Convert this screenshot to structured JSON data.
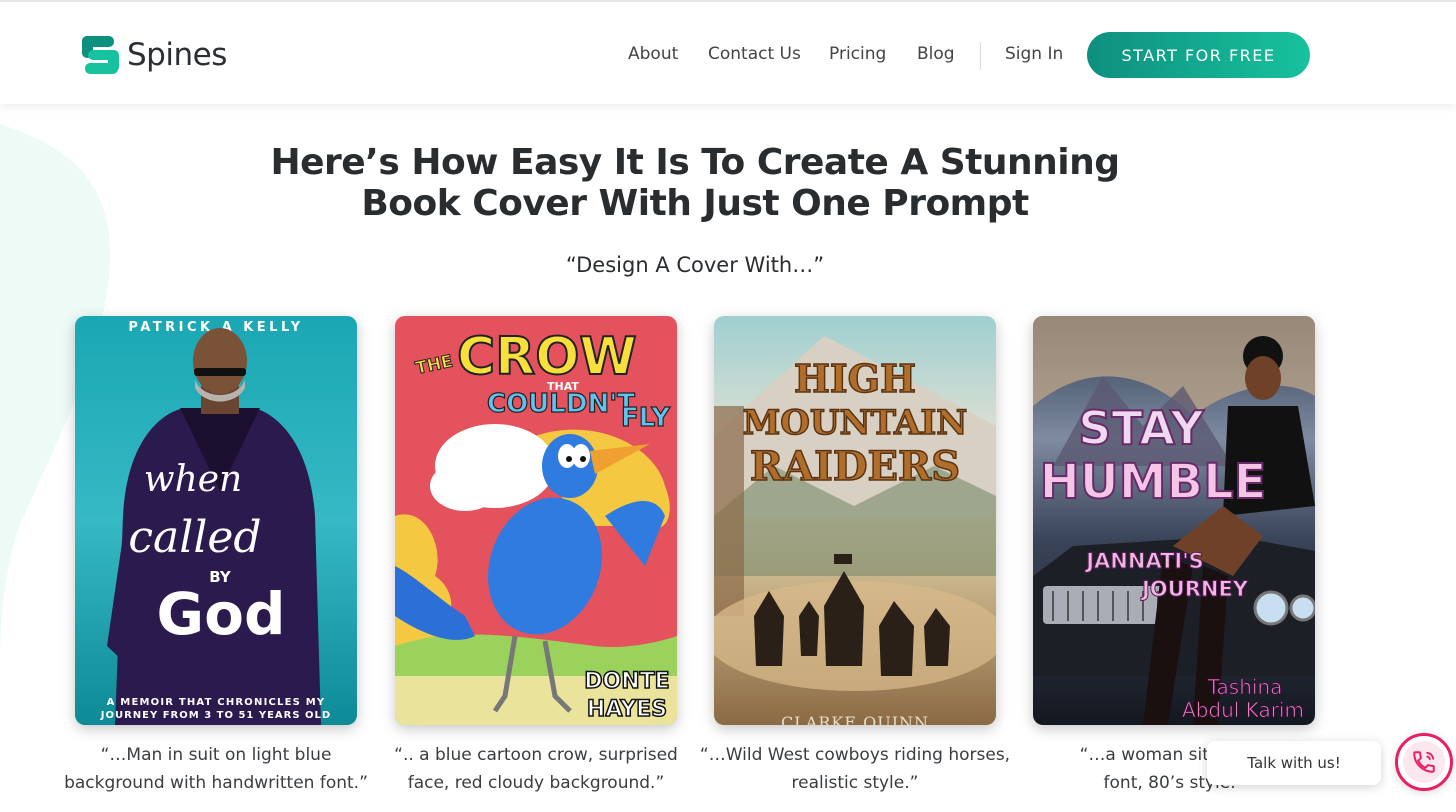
{
  "header": {
    "logo_text": "Spines",
    "nav": [
      "About",
      "Contact Us",
      "Pricing",
      "Blog"
    ],
    "sign_in": "Sign In",
    "cta": "START FOR FREE"
  },
  "hero": {
    "headline_line1": "Here’s How Easy It Is To Create A Stunning",
    "headline_line2": "Book Cover With Just One Prompt",
    "subheadline": "“Design A Cover With…”"
  },
  "covers": [
    {
      "author": "PATRICK A KELLY",
      "title_line1": "when",
      "title_line2": "called",
      "title_by": "BY",
      "title_line3": "God",
      "subtitle_line1": "A MEMOIR THAT CHRONICLES MY",
      "subtitle_line2": "JOURNEY FROM 3 TO 51 YEARS OLD",
      "caption_line1": "“…Man in suit on light blue",
      "caption_line2": "background with handwritten font.”"
    },
    {
      "title_the": "THE",
      "title_crow": "CROW",
      "title_that": "THAT",
      "title_couldnt": "COULDN'T",
      "title_fly": "FLY",
      "author_line1": "DONTE",
      "author_line2": "HAYES",
      "caption_line1": "“.. a blue cartoon crow, surprised",
      "caption_line2": "face, red cloudy background.”"
    },
    {
      "title_line1": "HIGH",
      "title_line2": "MOUNTAIN",
      "title_line3": "RAIDERS",
      "author": "CLARKE QUINN",
      "caption_line1": "“…Wild West cowboys riding horses,",
      "caption_line2": "realistic style.”"
    },
    {
      "title_line1": "STAY",
      "title_line2": "HUMBLE",
      "subtitle_line1": "JANNATI'S",
      "subtitle_line2": "JOURNEY",
      "author_line1": "Tashina",
      "author_line2": "Abdul Karim",
      "caption_line1": "“…a woman sitting on",
      "caption_line2": "font, 80’s style.”"
    }
  ],
  "chat": {
    "label": "Talk with us!"
  },
  "colors": {
    "brand_green": "#17b797",
    "cta_gradient_start": "#0f8f7e",
    "cta_gradient_end": "#17c29e",
    "chat_pink": "#e91e63"
  }
}
